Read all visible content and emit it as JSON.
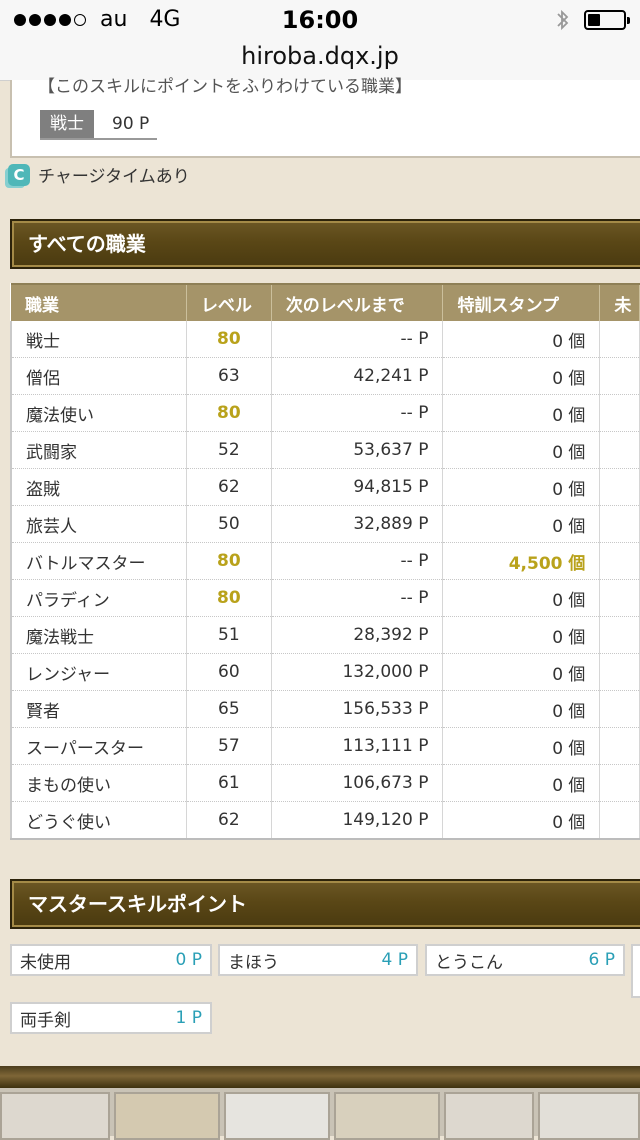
{
  "status_bar": {
    "carrier": "au",
    "network": "4G",
    "time": "16:00",
    "battery_level": 0.35
  },
  "url_bar": {
    "url": "hiroba.dqx.jp"
  },
  "skill_box": {
    "title": "【このスキルにポイントをふりわけている職業】",
    "job": "戦士",
    "points": "90 P"
  },
  "charge_note": {
    "icon_letter": "C",
    "text": "チャージタイムあり"
  },
  "all_jobs": {
    "title": "すべての職業",
    "columns": [
      "職業",
      "レベル",
      "次のレベルまで",
      "特訓スタンプ",
      "未"
    ],
    "rows": [
      {
        "job": "戦士",
        "level": "80",
        "next": "-- P",
        "stamp": "0 個",
        "level_max": true,
        "stamp_highlight": false
      },
      {
        "job": "僧侶",
        "level": "63",
        "next": "42,241 P",
        "stamp": "0 個",
        "level_max": false,
        "stamp_highlight": false
      },
      {
        "job": "魔法使い",
        "level": "80",
        "next": "-- P",
        "stamp": "0 個",
        "level_max": true,
        "stamp_highlight": false
      },
      {
        "job": "武闘家",
        "level": "52",
        "next": "53,637 P",
        "stamp": "0 個",
        "level_max": false,
        "stamp_highlight": false
      },
      {
        "job": "盗賊",
        "level": "62",
        "next": "94,815 P",
        "stamp": "0 個",
        "level_max": false,
        "stamp_highlight": false
      },
      {
        "job": "旅芸人",
        "level": "50",
        "next": "32,889 P",
        "stamp": "0 個",
        "level_max": false,
        "stamp_highlight": false
      },
      {
        "job": "バトルマスター",
        "level": "80",
        "next": "-- P",
        "stamp": "4,500 個",
        "level_max": true,
        "stamp_highlight": true
      },
      {
        "job": "パラディン",
        "level": "80",
        "next": "-- P",
        "stamp": "0 個",
        "level_max": true,
        "stamp_highlight": false
      },
      {
        "job": "魔法戦士",
        "level": "51",
        "next": "28,392 P",
        "stamp": "0 個",
        "level_max": false,
        "stamp_highlight": false
      },
      {
        "job": "レンジャー",
        "level": "60",
        "next": "132,000 P",
        "stamp": "0 個",
        "level_max": false,
        "stamp_highlight": false
      },
      {
        "job": "賢者",
        "level": "65",
        "next": "156,533 P",
        "stamp": "0 個",
        "level_max": false,
        "stamp_highlight": false
      },
      {
        "job": "スーパースター",
        "level": "57",
        "next": "113,111 P",
        "stamp": "0 個",
        "level_max": false,
        "stamp_highlight": false
      },
      {
        "job": "まもの使い",
        "level": "61",
        "next": "106,673 P",
        "stamp": "0 個",
        "level_max": false,
        "stamp_highlight": false
      },
      {
        "job": "どうぐ使い",
        "level": "62",
        "next": "149,120 P",
        "stamp": "0 個",
        "level_max": false,
        "stamp_highlight": false
      }
    ]
  },
  "master_skill": {
    "title": "マスタースキルポイント",
    "items": [
      {
        "label": "未使用",
        "points": "0 P"
      },
      {
        "label": "まほう",
        "points": "4 P"
      },
      {
        "label": "とうこん",
        "points": "6 P"
      },
      {
        "label": "両手剣",
        "points": "1 P"
      }
    ]
  },
  "colors": {
    "header_brown": "#5a4716",
    "table_head": "#a59469",
    "highlight_gold": "#b9a21b",
    "points_blue": "#2a9fb6",
    "page_bg": "#ece4d5"
  }
}
